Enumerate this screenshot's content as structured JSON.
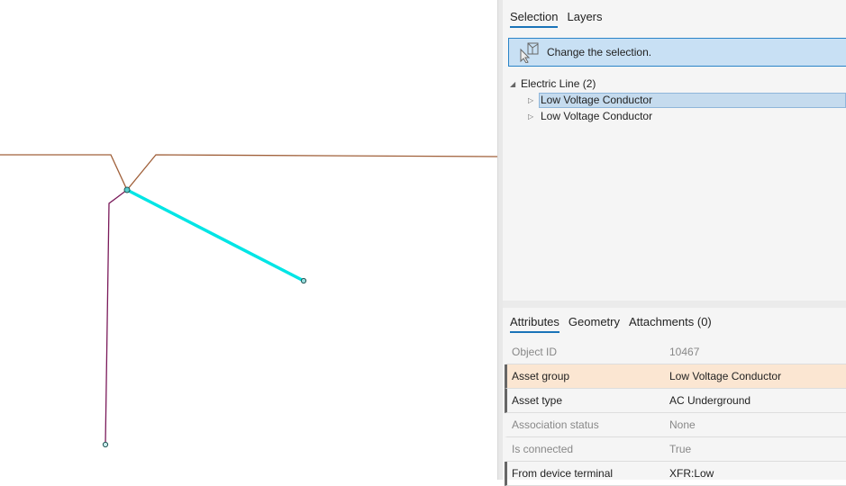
{
  "colors": {
    "accent": "#1a73b8",
    "selected_line": "#00e5e5",
    "brown_line": "#a0603a",
    "purple_line": "#7a1a5a"
  },
  "selection_tabs": [
    {
      "label": "Selection"
    },
    {
      "label": "Layers"
    }
  ],
  "banner": {
    "icon": "select-cursor-icon",
    "text": "Change the selection."
  },
  "tree": {
    "group": "Electric Line (2)",
    "items": [
      {
        "label": "Low Voltage Conductor",
        "selected": true
      },
      {
        "label": "Low Voltage Conductor",
        "selected": false
      }
    ]
  },
  "attr_tabs": [
    {
      "label": "Attributes"
    },
    {
      "label": "Geometry"
    },
    {
      "label": "Attachments (0)"
    }
  ],
  "attributes": [
    {
      "key": "Object ID",
      "value": "10467"
    },
    {
      "key": "Asset group",
      "value": "Low Voltage Conductor"
    },
    {
      "key": "Asset type",
      "value": "AC Underground"
    },
    {
      "key": "Association status",
      "value": "None"
    },
    {
      "key": "Is connected",
      "value": "True"
    },
    {
      "key": "From device terminal",
      "value": "XFR:Low"
    }
  ]
}
